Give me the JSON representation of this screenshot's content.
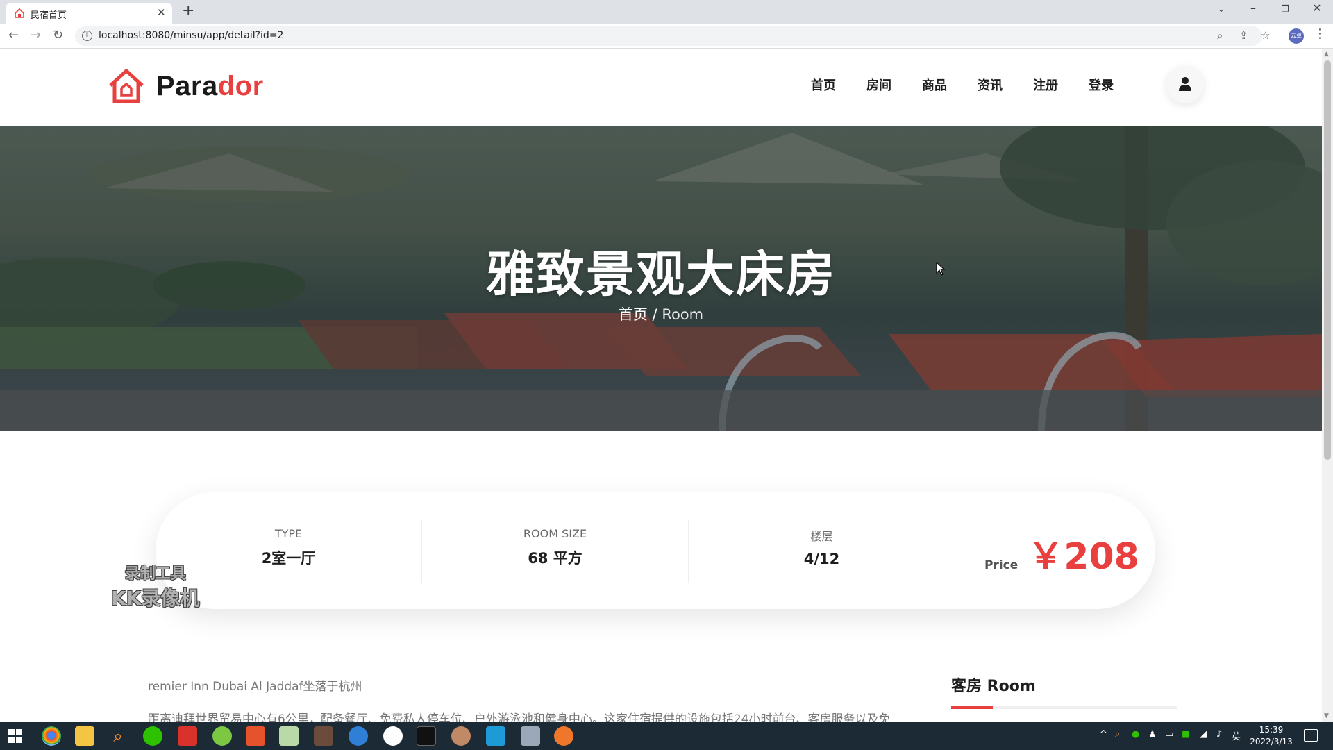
{
  "browser": {
    "tab_title": "民宿首页",
    "url": "localhost:8080/minsu/app/detail?id=2",
    "profile_initials": "云卓"
  },
  "header": {
    "logo_part1": "Para",
    "logo_part2": "dor",
    "nav": [
      "首页",
      "房间",
      "商品",
      "资讯",
      "注册",
      "登录"
    ]
  },
  "hero": {
    "title": "雅致景观大床房",
    "breadcrumb_home": "首页",
    "breadcrumb_sep": " / ",
    "breadcrumb_current": "Room"
  },
  "room_info": {
    "type_label": "TYPE",
    "type_value": "2室一厅",
    "size_label": "ROOM SIZE",
    "size_value": "68 平方",
    "floor_label": "楼层",
    "floor_value": "4/12",
    "price_label": "Price",
    "price_value": "￥208"
  },
  "watermark": {
    "line1": "录制工具",
    "line2": "KK录像机"
  },
  "description": {
    "line1": "remier Inn Dubai Al Jaddaf坐落于杭州",
    "line2": "距离迪拜世界贸易中心有6公里，配备餐厅、免费私人停车位、户外游泳池和健身中心。这家住宿提供的设施包括24小时前台、客房服务以及免"
  },
  "sidebar": {
    "title": "客房 Room"
  },
  "taskbar": {
    "time": "15:39",
    "date": "2022/3/13",
    "ime": "英"
  },
  "colors": {
    "accent": "#e8403f",
    "text_dark": "#1e1e1e",
    "taskbar": "#1c2a36"
  }
}
